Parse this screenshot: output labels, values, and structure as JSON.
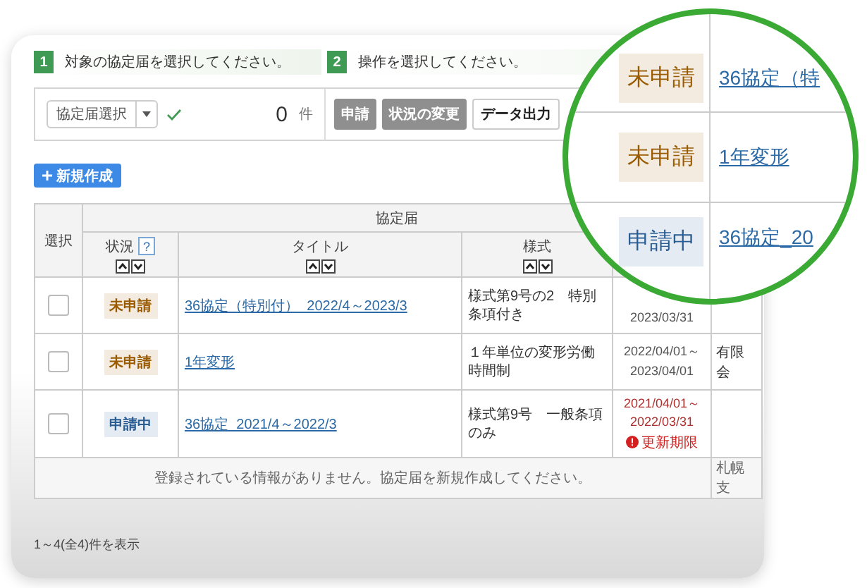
{
  "steps": [
    {
      "number": "1",
      "text": "対象の協定届を選択してください。"
    },
    {
      "number": "2",
      "text": "操作を選択してください。"
    }
  ],
  "toolbar": {
    "select_label": "協定届選択",
    "count": "0",
    "count_unit": "件",
    "buttons": [
      {
        "label": "申請",
        "disabled": true
      },
      {
        "label": "状況の変更",
        "disabled": true
      },
      {
        "label": "データ出力",
        "disabled": false
      }
    ]
  },
  "new_button": "新規作成",
  "table": {
    "select_header": "選択",
    "group_header": "協定届",
    "columns": [
      {
        "label": "状況",
        "help": "?"
      },
      {
        "label": "タイトル"
      },
      {
        "label": "様式"
      }
    ],
    "rows": [
      {
        "checked": false,
        "status": "未申請",
        "color": "#9a5a00",
        "title": "36協定（特別付）_2022/4～2023/3",
        "form": "様式第9号の2　特別条項付き",
        "period": [
          "2023/03/31"
        ],
        "expired": false
      },
      {
        "checked": false,
        "status": "未申請",
        "color": "#9a5a00",
        "title": "1年変形",
        "form": "１年単位の変形労働時間制",
        "period": [
          "2022/04/01～",
          "2023/04/01"
        ],
        "expired": false,
        "column_6": "有限会"
      },
      {
        "checked": false,
        "status": "申請中",
        "color": "#2a5d94",
        "title": "36協定_2021/4～2022/3",
        "form": "様式第9号　一般条項のみ",
        "period": [
          "2021/04/01～",
          "2022/03/31"
        ],
        "expired": true,
        "expiry_label": "更新期限"
      }
    ],
    "empty_message": "登録されている情報がありません。協定届を新規作成してください。",
    "empty_column_6": "札幌支"
  },
  "footer": "1～4(全4)件を表示",
  "magnifier": {
    "rows": [
      {
        "status": "未申請",
        "color": "#9a5a00",
        "title": "36協定（特"
      },
      {
        "status": "未申請",
        "color": "#9a5a00",
        "title": "1年変形"
      },
      {
        "status": "申請中",
        "color": "#2a5d94",
        "title": "36協定_20"
      }
    ]
  }
}
